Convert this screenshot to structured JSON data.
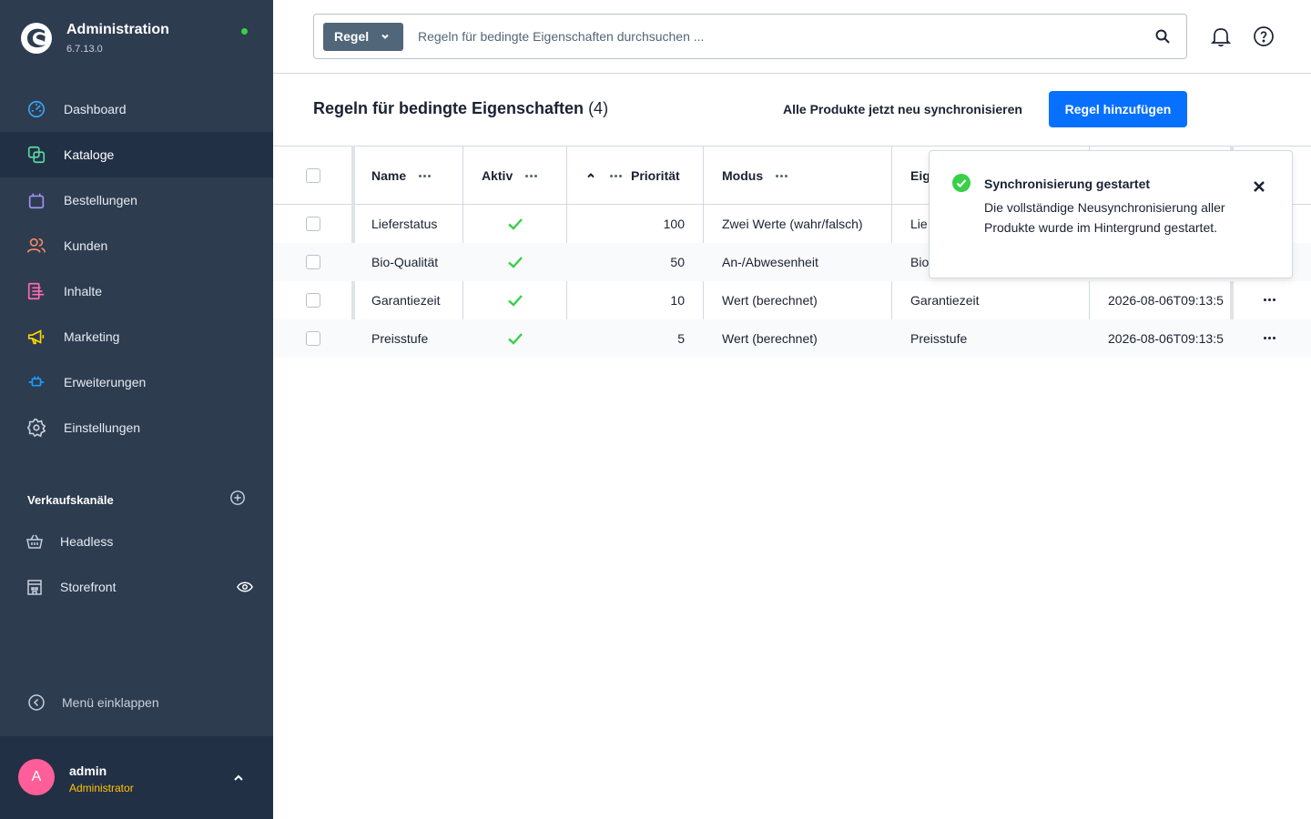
{
  "colors": {
    "sidebar_bg": "#2e3c50",
    "sidebar_active": "#223045",
    "primary": "#0870ff",
    "success": "#37d046",
    "avatar": "#ff5e99",
    "role": "#ffc400"
  },
  "app": {
    "title": "Administration",
    "version": "6.7.13.0"
  },
  "nav": [
    {
      "label": "Dashboard",
      "icon": "dashboard-icon"
    },
    {
      "label": "Kataloge",
      "icon": "catalog-icon",
      "active": true
    },
    {
      "label": "Bestellungen",
      "icon": "orders-icon"
    },
    {
      "label": "Kunden",
      "icon": "customers-icon"
    },
    {
      "label": "Inhalte",
      "icon": "content-icon"
    },
    {
      "label": "Marketing",
      "icon": "megaphone-icon"
    },
    {
      "label": "Erweiterungen",
      "icon": "plugin-icon"
    },
    {
      "label": "Einstellungen",
      "icon": "gear-icon"
    }
  ],
  "sales_channels": {
    "title": "Verkaufskanäle",
    "items": [
      {
        "label": "Headless",
        "icon": "basket-icon"
      },
      {
        "label": "Storefront",
        "icon": "storefront-icon"
      }
    ]
  },
  "collapse_label": "Menü einklappen",
  "user": {
    "initial": "A",
    "name": "admin",
    "role": "Administrator"
  },
  "search": {
    "type_label": "Regel",
    "placeholder": "Regeln für bedingte Eigenschaften durchsuchen ..."
  },
  "page": {
    "title": "Regeln für bedingte Eigenschaften",
    "count": "(4)",
    "sync_label": "Alle Produkte jetzt neu synchronisieren",
    "add_label": "Regel hinzufügen"
  },
  "table": {
    "columns": {
      "name": "Name",
      "active": "Aktiv",
      "priority": "Priorität",
      "mode": "Modus",
      "property": "Eig"
    },
    "rows": [
      {
        "name": "Lieferstatus",
        "priority": "100",
        "mode": "Zwei Werte (wahr/falsch)",
        "property": "Lie",
        "date": ""
      },
      {
        "name": "Bio-Qualität",
        "priority": "50",
        "mode": "An-/Abwesenheit",
        "property": "Bio",
        "date": ""
      },
      {
        "name": "Garantiezeit",
        "priority": "10",
        "mode": "Wert (berechnet)",
        "property": "Garantiezeit",
        "date": "2026-08-06T09:13:5"
      },
      {
        "name": "Preisstufe",
        "priority": "5",
        "mode": "Wert (berechnet)",
        "property": "Preisstufe",
        "date": "2026-08-06T09:13:5"
      }
    ]
  },
  "toast": {
    "title": "Synchronisierung gestartet",
    "message": "Die vollständige Neusynchronisierung aller Produkte wurde im Hintergrund gestartet."
  }
}
